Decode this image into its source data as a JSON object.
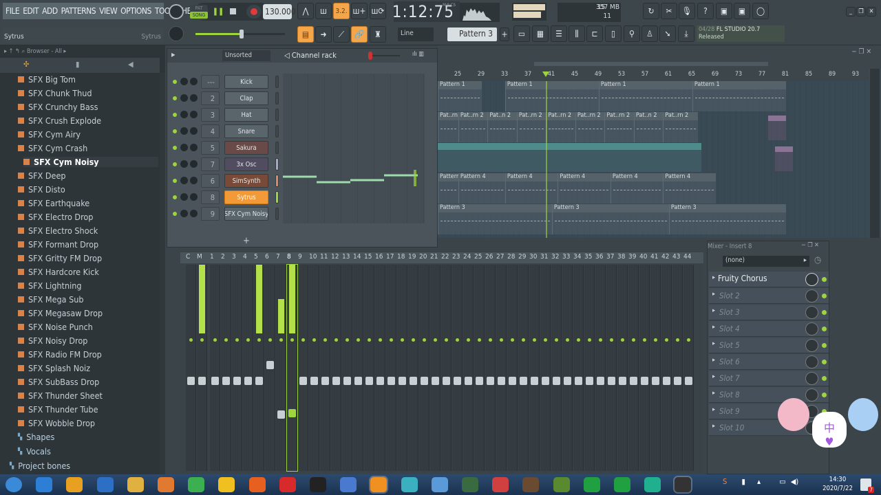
{
  "menu": [
    "FILE",
    "EDIT",
    "ADD",
    "PATTERNS",
    "VIEW",
    "OPTIONS",
    "TOOLS",
    "HELP"
  ],
  "hint": {
    "left": "Sytrus",
    "right": "Sytrus"
  },
  "transport": {
    "pat": "PAT",
    "song": "SONG",
    "tempo": "130.000",
    "time": "1:12:75",
    "time_label": "M:S:CS",
    "playing": true
  },
  "resources": {
    "cpu": "15",
    "memory": "357 MB",
    "polyphony": "11"
  },
  "snap": "Line",
  "pattern_selector": "Pattern 3",
  "news": {
    "date": "04/28",
    "title": "FL STUDIO 20.7",
    "status": "Released"
  },
  "colors": {
    "accent": "#f5a54a",
    "led": "#9ed43c",
    "teal": "#4e8c8c"
  },
  "browser": {
    "title": "Browser - All",
    "items": [
      "SFX Big Tom",
      "SFX Chunk Thud",
      "SFX Crunchy Bass",
      "SFX Crush Explode",
      "SFX Cym Airy",
      "SFX Cym Crash",
      "SFX Cym Noisy",
      "SFX Deep",
      "SFX Disto",
      "SFX Earthquake",
      "SFX Electro Drop",
      "SFX Electro Shock",
      "SFX Formant Drop",
      "SFX Gritty FM Drop",
      "SFX Hardcore Kick",
      "SFX Lightning",
      "SFX Mega Sub",
      "SFX Megasaw Drop",
      "SFX Noise Punch",
      "SFX Noisy Drop",
      "SFX Radio FM Drop",
      "SFX Splash Noiz",
      "SFX SubBass Drop",
      "SFX Thunder Sheet",
      "SFX Thunder Tube",
      "SFX Wobble Drop"
    ],
    "selected": "SFX Cym Noisy",
    "folders": [
      "Shapes",
      "Vocals",
      "Project bones"
    ]
  },
  "channel_rack": {
    "title": "Channel rack",
    "filter": "Unsorted",
    "add": "+",
    "channels": [
      {
        "num": "---",
        "name": "Kick",
        "color": "#5a656b"
      },
      {
        "num": "2",
        "name": "Clap",
        "color": "#5a656b"
      },
      {
        "num": "3",
        "name": "Hat",
        "color": "#5a656b"
      },
      {
        "num": "4",
        "name": "Snare",
        "color": "#5a656b"
      },
      {
        "num": "5",
        "name": "Sakura",
        "color": "#6a4a48"
      },
      {
        "num": "7",
        "name": "3x Osc",
        "color": "#524c60"
      },
      {
        "num": "6",
        "name": "SimSynth",
        "color": "#7a4a38"
      },
      {
        "num": "8",
        "name": "Sytrus",
        "color": "#f29a38",
        "selected": true
      },
      {
        "num": "9",
        "name": "SFX Cym Noisy",
        "color": "#5a656b"
      }
    ]
  },
  "playlist": {
    "ruler": [
      "25",
      "29",
      "33",
      "37",
      "41",
      "45",
      "49",
      "53",
      "57",
      "61",
      "65",
      "69",
      "73",
      "77",
      "81",
      "85",
      "89",
      "93"
    ],
    "playhead_bar": 40,
    "tracks": [
      {
        "clips": [
          {
            "label": "Pattern 1",
            "start": 17,
            "len": 12
          },
          {
            "label": "Pattern 1",
            "start": 33,
            "len": 16
          },
          {
            "label": "Pattern 1",
            "start": 49,
            "len": 16
          },
          {
            "label": "Pattern 1",
            "start": 65,
            "len": 16
          }
        ]
      },
      {
        "clips": [
          {
            "label": "Pat..rn 2",
            "start": 21,
            "len": 4
          },
          {
            "label": "Pat..rn 2",
            "start": 25,
            "len": 5
          },
          {
            "label": "Pat..n 2",
            "start": 30,
            "len": 5
          },
          {
            "label": "Pat..rn 2",
            "start": 35,
            "len": 5
          },
          {
            "label": "Pat..rn 2",
            "start": 40,
            "len": 5
          },
          {
            "label": "Pat..rn 2",
            "start": 45,
            "len": 5
          },
          {
            "label": "Pat..rn 2",
            "start": 50,
            "len": 5
          },
          {
            "label": "Pat..n 2",
            "start": 55,
            "len": 5
          },
          {
            "label": "Pat..rn 2",
            "start": 60,
            "len": 6
          }
        ]
      },
      {
        "audio": {
          "start": 21,
          "len": 45
        }
      },
      {
        "clips": [
          {
            "label": "Pattern 4",
            "start": 17,
            "len": 8
          },
          {
            "label": "Pattern 4",
            "start": 25,
            "len": 8
          },
          {
            "label": "Pattern 4",
            "start": 33,
            "len": 9
          },
          {
            "label": "Pattern 4",
            "start": 42,
            "len": 9
          },
          {
            "label": "Pattern 4",
            "start": 51,
            "len": 9
          },
          {
            "label": "Pattern 4",
            "start": 60,
            "len": 9
          }
        ]
      },
      {
        "clips": [
          {
            "label": "Pattern 3",
            "start": 21,
            "len": 20
          },
          {
            "label": "Pattern 3",
            "start": 41,
            "len": 20
          },
          {
            "label": "Pattern 3",
            "start": 61,
            "len": 20
          }
        ]
      }
    ]
  },
  "mixer": {
    "labels": {
      "current": "C",
      "master": "M"
    },
    "selected": 8,
    "strip_count": 44,
    "active": [
      5,
      7,
      8
    ]
  },
  "insert": {
    "title": "Mixer - Insert 8",
    "input": "(none)",
    "slots": [
      "Fruity Chorus",
      "Slot 2",
      "Slot 3",
      "Slot 4",
      "Slot 5",
      "Slot 6",
      "Slot 7",
      "Slot 8",
      "Slot 9",
      "Slot 10"
    ]
  },
  "taskbar": {
    "time": "14:30",
    "date": "2020/7/22",
    "notifications": "7",
    "apps": [
      "start",
      "internet-explorer",
      "360",
      "sogou-search",
      "file-explorer",
      "media-player",
      "green-app",
      "qq-music",
      "firefox",
      "netease-music",
      "qq",
      "video-app",
      "fl-studio",
      "snowflake-app",
      "globe-app",
      "monitor-app",
      "editor-app",
      "minecraft",
      "minecraft-alt",
      "play-app",
      "iqiyi",
      "green-browser",
      "obs"
    ]
  }
}
